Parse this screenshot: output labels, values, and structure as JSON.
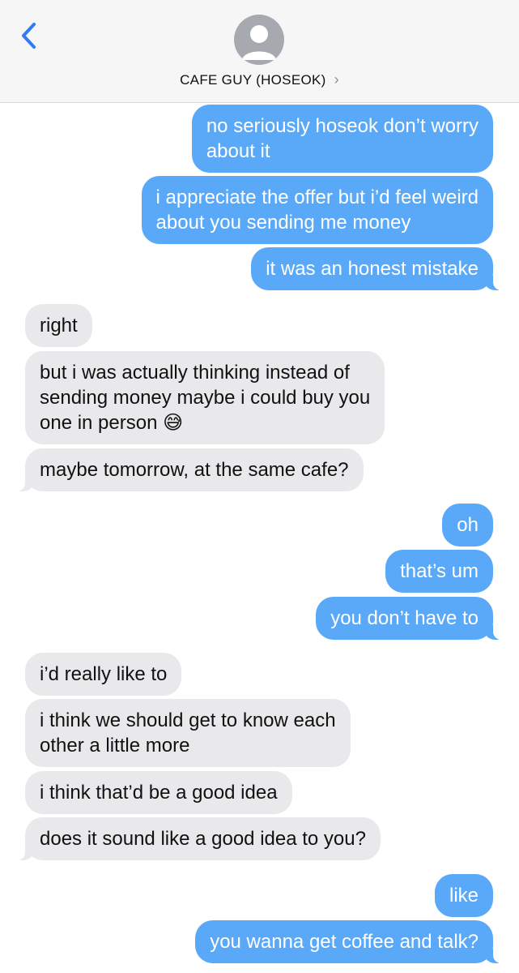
{
  "header": {
    "contact_name": "CAFE GUY (HOSEOK)",
    "chevron": "›",
    "back_icon": "chevron-left-icon",
    "avatar_icon": "person-silhouette-icon",
    "accent_color": "#2f7cf6"
  },
  "colors": {
    "outgoing_bubble": "#5aa9f8",
    "incoming_bubble": "#e9e9eb"
  },
  "messages": [
    {
      "from": "me",
      "text": "no seriously hoseok don’t worry\nabout it"
    },
    {
      "from": "me",
      "text": "i appreciate the offer but i’d feel weird\nabout you sending me money"
    },
    {
      "from": "me",
      "text": "it was an honest mistake"
    },
    {
      "from": "them",
      "text": "right"
    },
    {
      "from": "them",
      "text": "but i was actually thinking instead of\nsending money maybe i could buy you\none in person 😅"
    },
    {
      "from": "them",
      "text": "maybe tomorrow, at the same cafe?"
    },
    {
      "from": "me",
      "text": "oh"
    },
    {
      "from": "me",
      "text": "that’s um"
    },
    {
      "from": "me",
      "text": "you don’t have to"
    },
    {
      "from": "them",
      "text": "i’d really like to"
    },
    {
      "from": "them",
      "text": "i think we should get to know each\nother a little more"
    },
    {
      "from": "them",
      "text": "i think that’d be a good idea"
    },
    {
      "from": "them",
      "text": "does it sound like a good idea to you?"
    },
    {
      "from": "me",
      "text": "like"
    },
    {
      "from": "me",
      "text": "you wanna get coffee and talk?"
    }
  ]
}
